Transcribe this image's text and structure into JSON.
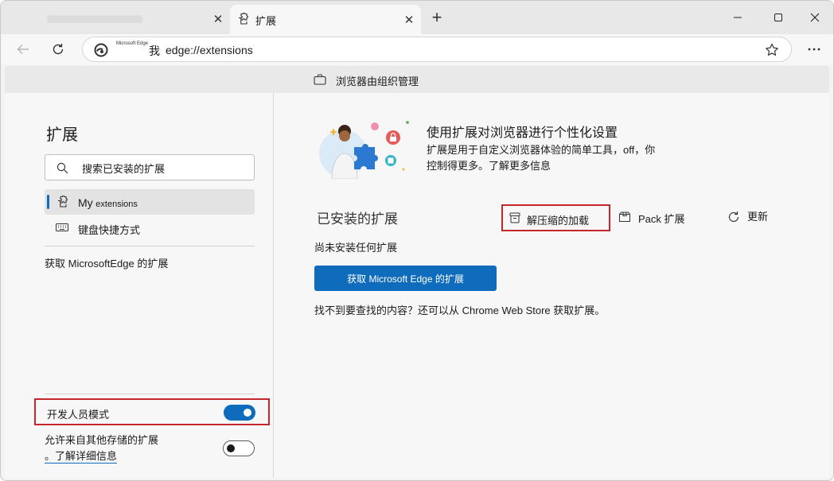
{
  "tabs": [
    {
      "title": "",
      "active": false
    },
    {
      "title": "扩展",
      "active": true
    }
  ],
  "address_bar": {
    "site_label_small": "Microsoft Edge",
    "site_label": "我",
    "url": "edge://extensions"
  },
  "managed_bar": {
    "text": "浏览器由组织管理"
  },
  "sidebar": {
    "title": "扩展",
    "search_placeholder": "搜索已安装的扩展",
    "items": [
      {
        "label_main": "My",
        "label_sub": "extensions",
        "icon": "puzzle-icon",
        "active": true
      },
      {
        "label": "键盘快捷方式",
        "icon": "keyboard-icon",
        "active": false
      }
    ],
    "get_link": "获取 MicrosoftEdge 的扩展",
    "developer_mode": {
      "label": "开发人员模式",
      "enabled": true
    },
    "allow_other_stores": {
      "text": "允许来自其他存储的扩展",
      "link": "。了解详细信息",
      "enabled": false
    }
  },
  "main": {
    "hero_title": "使用扩展对浏览器进行个性化设置",
    "hero_description": "扩展是用于自定义浏览器体验的简单工具，off，你控制得更多。了解更多信息",
    "installed_title": "已安装的扩展",
    "load_unpacked_label": "解压缩的加载",
    "pack_label": "Pack 扩展",
    "update_label": "更新",
    "no_extensions_text": "尚未安装任何扩展",
    "get_extensions_button": "获取 Microsoft Edge 的扩展",
    "help_text": "找不到要查找的内容？还可以从 Chrome Web Store 获取扩展。"
  },
  "colors": {
    "accent": "#0f6cbd",
    "highlight_border": "#c4262e"
  }
}
